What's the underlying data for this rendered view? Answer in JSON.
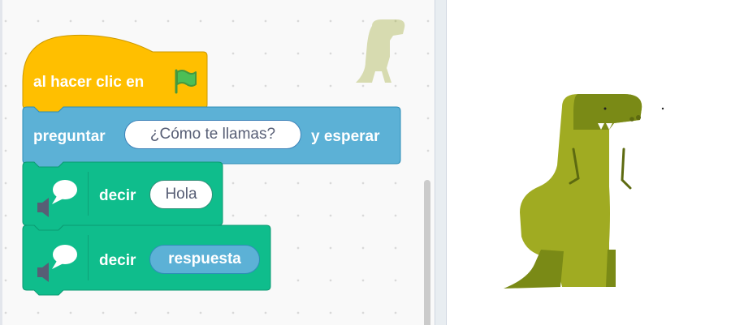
{
  "script": {
    "hat_block": {
      "label": "al hacer clic en",
      "icon": "green-flag-icon"
    },
    "ask_block": {
      "label": "preguntar",
      "question": "¿Cómo te llamas?",
      "suffix": "y esperar"
    },
    "say_block_1": {
      "label": "decir",
      "message": "Hola",
      "icon": "speech-bubble-icon"
    },
    "say_block_2": {
      "label": "decir",
      "reporter": "respuesta",
      "icon": "speech-bubble-icon"
    }
  },
  "colors": {
    "events": "#ffbf00",
    "sensing": "#5cb1d6",
    "extension": "#0fbd8c",
    "dino_light": "#a0ab22",
    "dino_dark": "#7a8a16"
  },
  "stage": {
    "sprite": "dinosaur"
  }
}
